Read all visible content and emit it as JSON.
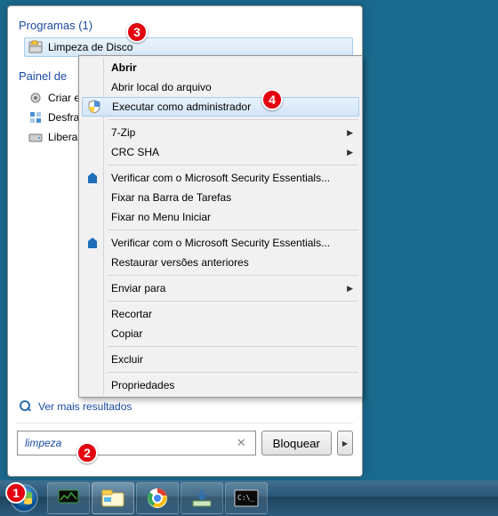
{
  "start": {
    "programs_heading": "Programas (1)",
    "program_item": "Limpeza de Disco",
    "panel_heading": "Painel de",
    "panel_items": [
      "Criar e",
      "Desfra",
      "Libera"
    ],
    "see_more": "Ver mais resultados",
    "search_value": "limpeza",
    "lock_label": "Bloquear"
  },
  "context": {
    "open": "Abrir",
    "open_location": "Abrir local do arquivo",
    "run_admin": "Executar como administrador",
    "seven_zip": "7-Zip",
    "crc_sha": "CRC SHA",
    "mse": "Verificar com o Microsoft Security Essentials...",
    "pin_taskbar": "Fixar na Barra de Tarefas",
    "pin_start": "Fixar no Menu Iniciar",
    "mse2": "Verificar com o Microsoft Security Essentials...",
    "restore": "Restaurar versões anteriores",
    "send_to": "Enviar para",
    "cut": "Recortar",
    "copy": "Copiar",
    "delete": "Excluir",
    "properties": "Propriedades"
  },
  "badges": {
    "b1": "1",
    "b2": "2",
    "b3": "3",
    "b4": "4"
  }
}
